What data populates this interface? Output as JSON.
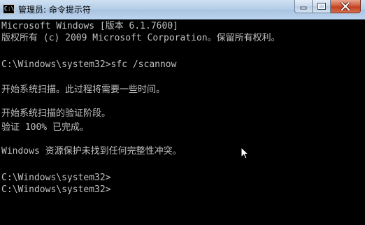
{
  "window": {
    "title": "管理员: 命令提示符",
    "app_icon_text": "C:\\",
    "buttons": {
      "minimize_icon": "minimize-icon",
      "maximize_icon": "maximize-icon",
      "close_icon": "close-icon"
    }
  },
  "console": {
    "lines": [
      "Microsoft Windows [版本 6.1.7600]",
      "版权所有 (c) 2009 Microsoft Corporation。保留所有权利。",
      "",
      "C:\\Windows\\system32>sfc /scannow",
      "",
      "开始系统扫描。此过程将需要一些时间。",
      "",
      "开始系统扫描的验证阶段。",
      "验证 100% 已完成。",
      "",
      "Windows 资源保护未找到任何完整性冲突。",
      "",
      "C:\\Windows\\system32>",
      "C:\\Windows\\system32>"
    ],
    "text_color": "#c0c0c0",
    "background": "#000000"
  }
}
